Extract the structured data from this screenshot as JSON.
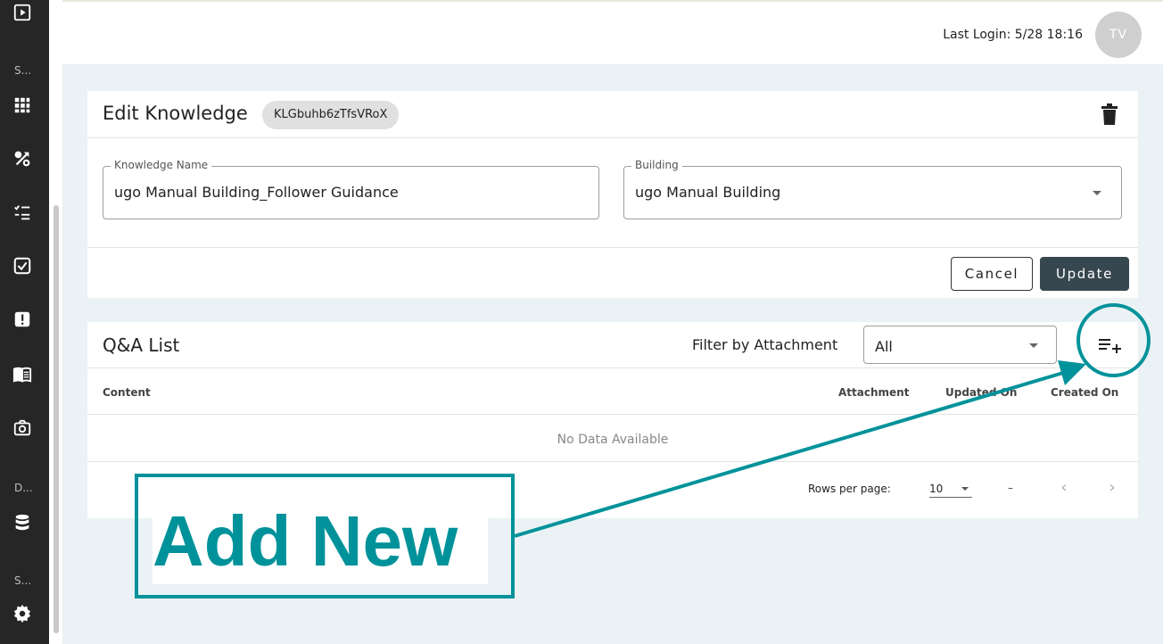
{
  "sidebar": {
    "labels": [
      "S...",
      "D...",
      "S..."
    ],
    "icons": [
      "play-box-icon",
      "apps-grid-icon",
      "workflow-icon",
      "checklist-icon",
      "task-check-icon",
      "alert-icon",
      "book-icon",
      "camera-icon",
      "database-icon",
      "gear-icon"
    ]
  },
  "header": {
    "last_login": "Last Login: 5/28 18:16",
    "avatar_initials": "TV"
  },
  "edit_knowledge": {
    "title": "Edit Knowledge",
    "id_chip": "KLGbuhb6zTfsVRoX",
    "name_label": "Knowledge Name",
    "name_value": "ugo Manual Building_Follower Guidance",
    "building_label": "Building",
    "building_value": "ugo Manual Building",
    "cancel_label": "Cancel",
    "update_label": "Update"
  },
  "qa_list": {
    "title": "Q&A List",
    "filter_label": "Filter by Attachment",
    "filter_value": "All",
    "columns": {
      "content": "Content",
      "attachment": "Attachment",
      "updated_on": "Updated On",
      "created_on": "Created On"
    },
    "empty_text": "No Data Available",
    "rows_per_page_label": "Rows per page:",
    "rows_per_page_value": "10",
    "range_text": "–",
    "prev_symbol": "‹",
    "next_symbol": "›"
  },
  "annotation": {
    "text": "Add New",
    "color": "#00929a"
  }
}
